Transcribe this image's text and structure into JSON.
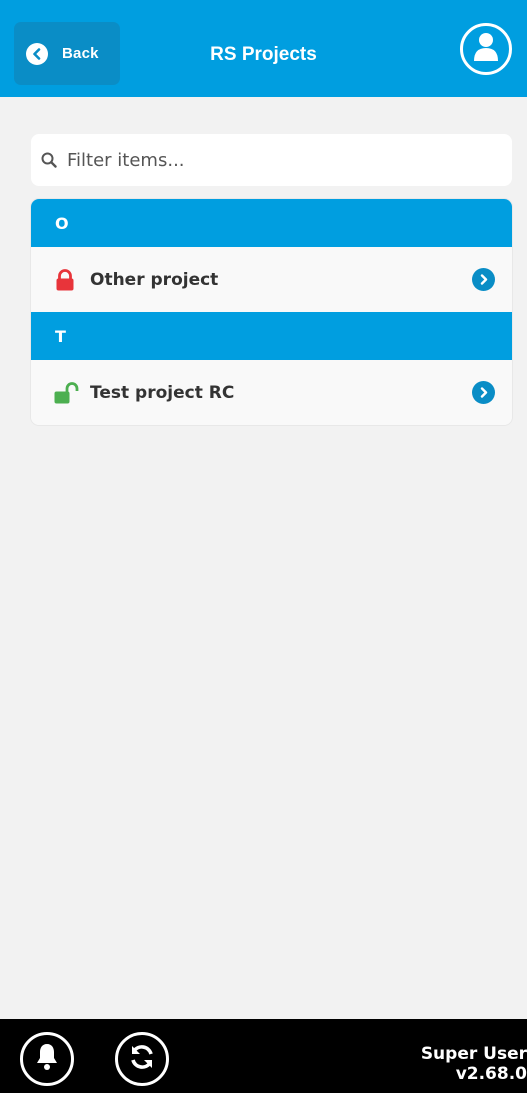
{
  "header": {
    "back_label": "Back",
    "title": "RS Projects"
  },
  "search": {
    "placeholder": "Filter items..."
  },
  "groups": [
    {
      "letter": "O",
      "items": [
        {
          "label": "Other project",
          "lock": "locked",
          "lock_color": "#e8343a"
        }
      ]
    },
    {
      "letter": "T",
      "items": [
        {
          "label": "Test project RC",
          "lock": "unlocked",
          "lock_color": "#4caf50"
        }
      ]
    }
  ],
  "footer": {
    "user_name": "Super User",
    "version": "v2.68.0"
  },
  "colors": {
    "accent": "#009ee0",
    "footer_bg": "#000000",
    "background": "#f2f2f2"
  },
  "icons": {
    "back": "chevron-left-icon",
    "avatar": "user-icon",
    "search": "search-icon",
    "row_chevron": "chevron-right-icon",
    "notifications": "bell-icon",
    "sync": "refresh-icon"
  }
}
